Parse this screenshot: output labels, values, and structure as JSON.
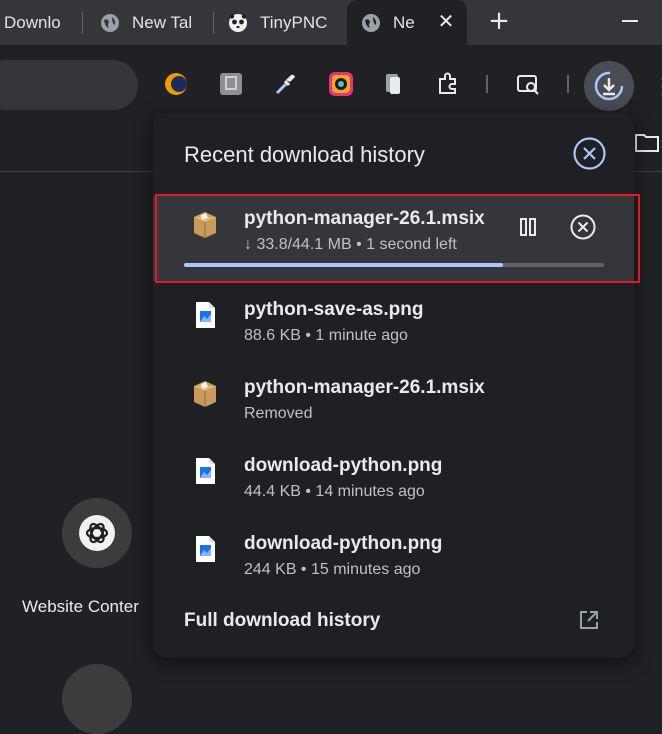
{
  "tabs": [
    {
      "label": "Downlo"
    },
    {
      "label": "New Tal"
    },
    {
      "label": "TinyPNC"
    },
    {
      "label": "Ne"
    }
  ],
  "tab_close_label": "✕",
  "new_tab_label": "+",
  "menu_label": "⋮",
  "ntp": {
    "shortcut_label": "Website Conter"
  },
  "download_panel": {
    "title": "Recent download history",
    "items": [
      {
        "name": "python-manager-26.1.msix",
        "status": "↓ 33.8/44.1 MB • 1 second left",
        "type": "package",
        "progress": 0.76,
        "active": true
      },
      {
        "name": "python-save-as.png",
        "status": "88.6 KB • 1 minute ago",
        "type": "image"
      },
      {
        "name": "python-manager-26.1.msix",
        "status": "Removed",
        "type": "package"
      },
      {
        "name": "download-python.png",
        "status": "44.4 KB • 14 minutes ago",
        "type": "image"
      },
      {
        "name": "download-python.png",
        "status": "244 KB • 15 minutes ago",
        "type": "image"
      }
    ],
    "footer_link": "Full download history"
  },
  "colors": {
    "accent": "#a8c7fa",
    "highlight_box": "#e01b24",
    "panel_bg": "#1f2024"
  },
  "icons": [
    "globe-icon",
    "panda-icon",
    "close-icon",
    "plus-icon",
    "extension-icon",
    "eyedropper-icon",
    "download-icon",
    "folder-icon",
    "package-icon",
    "image-file-icon",
    "pause-icon",
    "cancel-icon",
    "open-external-icon",
    "chatgpt-icon"
  ]
}
